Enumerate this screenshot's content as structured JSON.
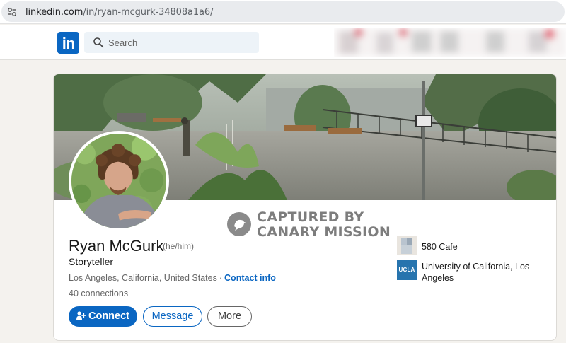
{
  "browser": {
    "url_domain": "linkedin.com",
    "url_path": "/in/ryan-mcgurk-34808a1a6/"
  },
  "header": {
    "logo_text": "in",
    "search_placeholder": "Search"
  },
  "watermark": {
    "line1": "CAPTURED BY",
    "line2": "CANARY MISSION"
  },
  "profile": {
    "name": "Ryan McGurk",
    "pronouns": "(he/him)",
    "headline": "Storyteller",
    "location": "Los Angeles, California, United States",
    "separator": "·",
    "contact_label": "Contact info",
    "connections": "40 connections"
  },
  "actions": {
    "connect_label": "Connect",
    "message_label": "Message",
    "more_label": "More"
  },
  "experience": [
    {
      "org": "580 Cafe"
    },
    {
      "org": "University of California, Los Angeles",
      "logo_text": "UCLA"
    }
  ],
  "colors": {
    "brand": "#0a66c2",
    "page_bg": "#f4f2ee",
    "ucla_blue": "#2774ae"
  }
}
